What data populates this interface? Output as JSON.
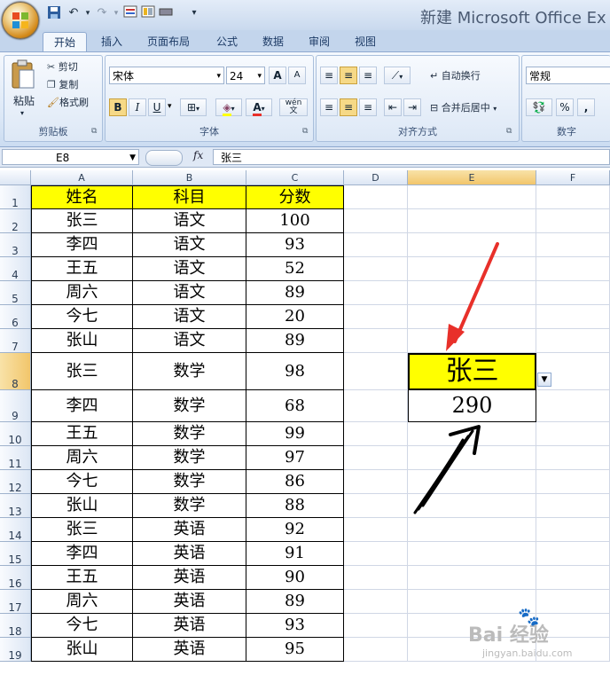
{
  "app": {
    "title": "新建 Microsoft Office Ex",
    "tabs": [
      "开始",
      "插入",
      "页面布局",
      "公式",
      "数据",
      "审阅",
      "视图"
    ]
  },
  "ribbon": {
    "clipboard": {
      "paste": "粘贴",
      "cut": "剪切",
      "copy": "复制",
      "format_painter": "格式刷",
      "label": "剪贴板"
    },
    "font": {
      "name": "宋体",
      "size": "24",
      "bold": "B",
      "italic": "I",
      "underline": "U",
      "grow": "A",
      "shrink": "A",
      "label": "字体",
      "ime": "wén",
      "phonetic_glyph": "文"
    },
    "alignment": {
      "wrap": "自动换行",
      "merge": "合并后居中",
      "label": "对齐方式"
    },
    "number": {
      "format": "常规",
      "percent": "%",
      "comma": ",",
      "label": "数字"
    }
  },
  "formula_bar": {
    "cell_ref": "E8",
    "fx": "fx",
    "content": "张三"
  },
  "columns": [
    "A",
    "B",
    "C",
    "D",
    "E",
    "F"
  ],
  "rows": [
    [
      "姓名",
      "科目",
      "分数"
    ],
    [
      "张三",
      "语文",
      "100"
    ],
    [
      "李四",
      "语文",
      "93"
    ],
    [
      "王五",
      "语文",
      "52"
    ],
    [
      "周六",
      "语文",
      "89"
    ],
    [
      "今七",
      "语文",
      "20"
    ],
    [
      "张山",
      "语文",
      "89"
    ],
    [
      "张三",
      "数学",
      "98"
    ],
    [
      "李四",
      "数学",
      "68"
    ],
    [
      "王五",
      "数学",
      "99"
    ],
    [
      "周六",
      "数学",
      "97"
    ],
    [
      "今七",
      "数学",
      "86"
    ],
    [
      "张山",
      "数学",
      "88"
    ],
    [
      "张三",
      "英语",
      "92"
    ],
    [
      "李四",
      "英语",
      "91"
    ],
    [
      "王五",
      "英语",
      "90"
    ],
    [
      "周六",
      "英语",
      "89"
    ],
    [
      "今七",
      "英语",
      "93"
    ],
    [
      "张山",
      "英语",
      "95"
    ]
  ],
  "lookup": {
    "name": "张三",
    "total": "290"
  },
  "colors": {
    "highlight": "#ffff00",
    "arrow_red": "#e8302a",
    "arrow_black": "#000000",
    "header_blue": "#dce6f4"
  },
  "watermark": {
    "text": "Bai 经验",
    "url": "jingyan.baidu.com"
  }
}
